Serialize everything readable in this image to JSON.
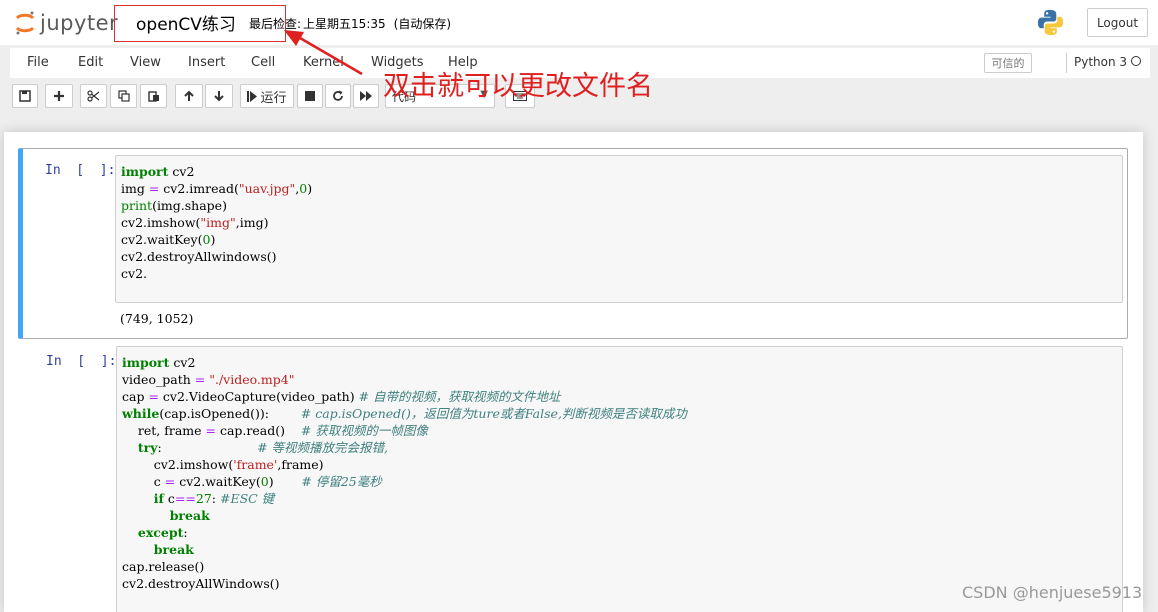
{
  "header": {
    "logo_text": "jupyter",
    "notebook_name": "openCV练习",
    "checkpoint_label": "最后检查:",
    "checkpoint_time": "上星期五15:35",
    "autosave": "(自动保存)",
    "logout_label": "Logout"
  },
  "menubar": {
    "items": [
      "File",
      "Edit",
      "View",
      "Insert",
      "Cell",
      "Kernel",
      "Widgets",
      "Help"
    ],
    "trusted_label": "可信的",
    "kernel_name": "Python 3"
  },
  "toolbar": {
    "run_label": "运行",
    "cell_type": "代码"
  },
  "annotation": {
    "text": "双击就可以更改文件名",
    "color": "#e02020"
  },
  "cells": [
    {
      "prompt": "In  [  ]:",
      "lines": [
        [
          [
            "kw",
            "import"
          ],
          [
            "t",
            " cv2"
          ]
        ],
        [
          [
            "t",
            "img "
          ],
          [
            "op",
            "="
          ],
          [
            "t",
            " cv2.imread("
          ],
          [
            "str",
            "\"uav.jpg\""
          ],
          [
            "t",
            ","
          ],
          [
            "num",
            "0"
          ],
          [
            "t",
            ")"
          ]
        ],
        [
          [
            "kw2",
            "print"
          ],
          [
            "t",
            "(img.shape)"
          ]
        ],
        [
          [
            "t",
            "cv2.imshow("
          ],
          [
            "str",
            "\"img\""
          ],
          [
            "t",
            ",img)"
          ]
        ],
        [
          [
            "t",
            "cv2.waitKey("
          ],
          [
            "num",
            "0"
          ],
          [
            "t",
            ")"
          ]
        ],
        [
          [
            "t",
            "cv2.destroyAllwindows()"
          ]
        ],
        [
          [
            "t",
            "cv2."
          ]
        ]
      ],
      "output": "(749, 1052)"
    },
    {
      "prompt": "In  [  ]:",
      "lines": [
        [
          [
            "kw",
            "import"
          ],
          [
            "t",
            " cv2"
          ]
        ],
        [
          [
            "t",
            "video_path "
          ],
          [
            "op",
            "="
          ],
          [
            "t",
            " "
          ],
          [
            "str",
            "\"./video.mp4\""
          ]
        ],
        [
          [
            "t",
            "cap "
          ],
          [
            "op",
            "="
          ],
          [
            "t",
            " cv2.VideoCapture(video_path) "
          ],
          [
            "cm",
            "# 自带的视频，获取视频的文件地址"
          ]
        ],
        [
          [
            "kw",
            "while"
          ],
          [
            "t",
            "(cap.isOpened()):        "
          ],
          [
            "cm",
            "# cap.isOpened()，返回值为ture或者False,判断视频是否读取成功"
          ]
        ],
        [
          [
            "t",
            "    ret, frame "
          ],
          [
            "op",
            "="
          ],
          [
            "t",
            " cap.read()    "
          ],
          [
            "cm",
            "# 获取视频的一帧图像"
          ]
        ],
        [
          [
            "t",
            "    "
          ],
          [
            "kw",
            "try"
          ],
          [
            "t",
            ":                        "
          ],
          [
            "cm",
            "# 等视频播放完会报错,"
          ]
        ],
        [
          [
            "t",
            "        cv2.imshow("
          ],
          [
            "str",
            "'frame'"
          ],
          [
            "t",
            ",frame)"
          ]
        ],
        [
          [
            "t",
            "        c "
          ],
          [
            "op",
            "="
          ],
          [
            "t",
            " cv2.waitKey("
          ],
          [
            "num",
            "0"
          ],
          [
            "t",
            ")       "
          ],
          [
            "cm",
            "# 停留25毫秒"
          ]
        ],
        [
          [
            "t",
            "        "
          ],
          [
            "kw",
            "if"
          ],
          [
            "t",
            " c"
          ],
          [
            "op",
            "=="
          ],
          [
            "num",
            "27"
          ],
          [
            "t",
            ": "
          ],
          [
            "cm",
            "#ESC 键"
          ]
        ],
        [
          [
            "t",
            "            "
          ],
          [
            "kw",
            "break"
          ]
        ],
        [
          [
            "t",
            "    "
          ],
          [
            "kw",
            "except"
          ],
          [
            "t",
            ":"
          ]
        ],
        [
          [
            "t",
            "        "
          ],
          [
            "kw",
            "break"
          ]
        ],
        [
          [
            "t",
            "cap.release()"
          ]
        ],
        [
          [
            "t",
            "cv2.destroyAllWindows()"
          ]
        ]
      ]
    }
  ],
  "watermark": "CSDN @henjuese5913"
}
